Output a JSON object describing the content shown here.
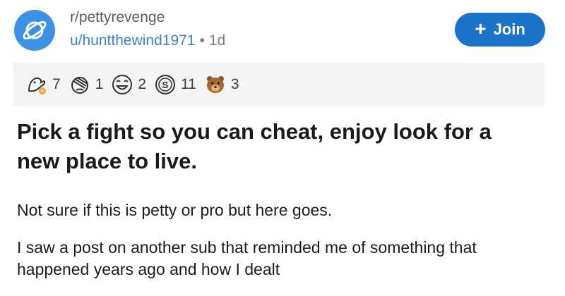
{
  "post": {
    "subreddit": "r/pettyrevenge",
    "author": "u/huntthewind1971",
    "separator": "•",
    "age": "1d",
    "join_label": "Join",
    "join_icon": "plus-icon"
  },
  "awards": [
    {
      "icon": "wholesome-seal-award-icon",
      "count": "7"
    },
    {
      "icon": "facepalm-award-icon",
      "count": "1"
    },
    {
      "icon": "laughing-face-award-icon",
      "count": "2"
    },
    {
      "icon": "silver-coin-award-icon",
      "count": "11"
    },
    {
      "icon": "bear-award-icon",
      "count": "3"
    }
  ],
  "title": "Pick a fight so you can cheat, enjoy look for a new place to live.",
  "body": {
    "p1": "Not sure if this is petty or pro but here goes.",
    "p2": "I saw a post on another sub that reminded me of something that happened years ago and how I dealt"
  },
  "colors": {
    "accent": "#1a73c9",
    "link": "#3b82d1",
    "avatar": "#3c91e6",
    "award_bar": "#f4f4f4"
  }
}
